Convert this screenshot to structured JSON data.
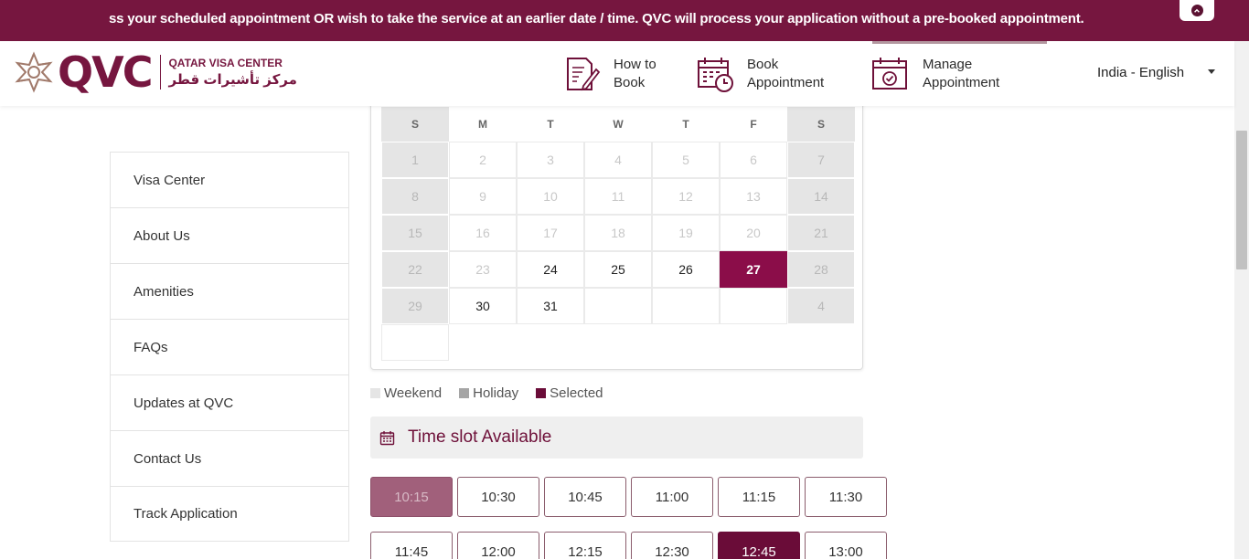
{
  "banner": {
    "text": "ss your scheduled appointment OR wish to take the service at an earlier date / time. QVC will process your application without a pre-booked appointment."
  },
  "logo": {
    "brand": "QVC",
    "english": "QATAR VISA CENTER",
    "arabic": "مركز تأشيرات قطر"
  },
  "nav": {
    "how_to_book": [
      "How to",
      "Book"
    ],
    "book_appointment": [
      "Book",
      "Appointment"
    ],
    "manage_appointment": [
      "Manage",
      "Appointment"
    ],
    "language": "India - English"
  },
  "sidebar": {
    "items": [
      {
        "label": "Visa Center"
      },
      {
        "label": "About Us"
      },
      {
        "label": "Amenities"
      },
      {
        "label": "FAQs"
      },
      {
        "label": "Updates at QVC"
      },
      {
        "label": "Contact Us"
      },
      {
        "label": "Track Application"
      }
    ]
  },
  "calendar": {
    "weekdays": [
      "S",
      "M",
      "T",
      "W",
      "T",
      "F",
      "S"
    ],
    "weeks": [
      [
        {
          "d": "1",
          "s": "weekend"
        },
        {
          "d": "2",
          "s": "disabled"
        },
        {
          "d": "3",
          "s": "disabled"
        },
        {
          "d": "4",
          "s": "disabled"
        },
        {
          "d": "5",
          "s": "disabled"
        },
        {
          "d": "6",
          "s": "disabled"
        },
        {
          "d": "7",
          "s": "weekend"
        }
      ],
      [
        {
          "d": "8",
          "s": "weekend"
        },
        {
          "d": "9",
          "s": "disabled"
        },
        {
          "d": "10",
          "s": "disabled"
        },
        {
          "d": "11",
          "s": "disabled"
        },
        {
          "d": "12",
          "s": "disabled"
        },
        {
          "d": "13",
          "s": "disabled"
        },
        {
          "d": "14",
          "s": "weekend"
        }
      ],
      [
        {
          "d": "15",
          "s": "weekend"
        },
        {
          "d": "16",
          "s": "disabled"
        },
        {
          "d": "17",
          "s": "disabled"
        },
        {
          "d": "18",
          "s": "disabled"
        },
        {
          "d": "19",
          "s": "disabled"
        },
        {
          "d": "20",
          "s": "disabled"
        },
        {
          "d": "21",
          "s": "weekend"
        }
      ],
      [
        {
          "d": "22",
          "s": "weekend"
        },
        {
          "d": "23",
          "s": "disabled"
        },
        {
          "d": "24",
          "s": "active"
        },
        {
          "d": "25",
          "s": "active"
        },
        {
          "d": "26",
          "s": "active"
        },
        {
          "d": "27",
          "s": "selected"
        },
        {
          "d": "28",
          "s": "weekend"
        }
      ],
      [
        {
          "d": "29",
          "s": "weekend"
        },
        {
          "d": "30",
          "s": "active"
        },
        {
          "d": "31",
          "s": "active"
        },
        {
          "d": "",
          "s": "empty"
        },
        {
          "d": "",
          "s": "empty"
        },
        {
          "d": "",
          "s": "empty"
        },
        {
          "d": "4",
          "s": "weekend"
        }
      ],
      [
        {
          "d": "",
          "s": "empty"
        }
      ]
    ]
  },
  "legend": [
    {
      "label": "Weekend",
      "color": "#e5e5e5"
    },
    {
      "label": "Holiday",
      "color": "#a5a5a5"
    },
    {
      "label": "Selected",
      "color": "#6a0c38"
    }
  ],
  "timeslots": {
    "title": "Time slot Available",
    "slots": [
      {
        "time": "10:15",
        "state": "disabled"
      },
      {
        "time": "10:30",
        "state": "available"
      },
      {
        "time": "10:45",
        "state": "available"
      },
      {
        "time": "11:00",
        "state": "available"
      },
      {
        "time": "11:15",
        "state": "available"
      },
      {
        "time": "11:30",
        "state": "available"
      },
      {
        "time": "11:45",
        "state": "available"
      },
      {
        "time": "12:00",
        "state": "available"
      },
      {
        "time": "12:15",
        "state": "available"
      },
      {
        "time": "12:30",
        "state": "available"
      },
      {
        "time": "12:45",
        "state": "selected"
      },
      {
        "time": "13:00",
        "state": "available"
      }
    ]
  },
  "colors": {
    "brand": "#76163f",
    "selected": "#8b0d49"
  }
}
